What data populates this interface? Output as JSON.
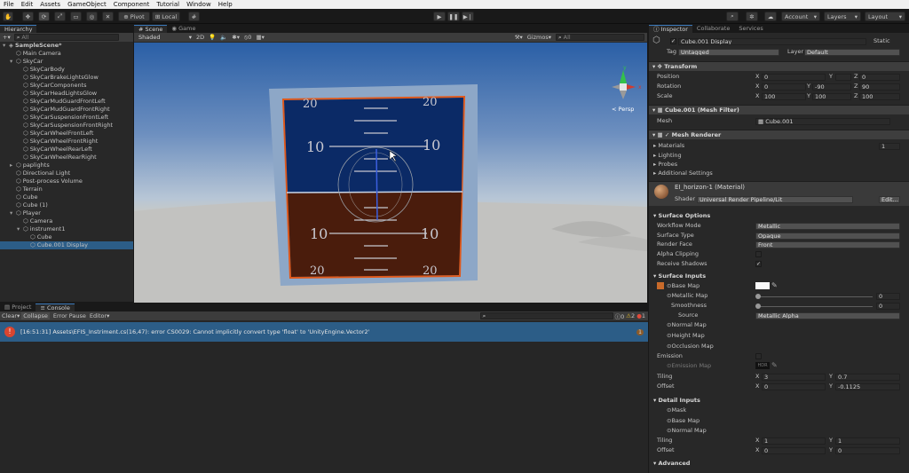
{
  "menubar": [
    "File",
    "Edit",
    "Assets",
    "GameObject",
    "Component",
    "Tutorial",
    "Window",
    "Help"
  ],
  "toolbar": {
    "pivot": "Pivot",
    "local": "Local",
    "account": "Account",
    "layers": "Layers",
    "layout": "Layout"
  },
  "hierarchy": {
    "tab": "Hierarchy",
    "search_placeholder": "All",
    "items": [
      {
        "label": "SampleScene*",
        "depth": 0
      },
      {
        "label": "Main Camera",
        "depth": 1
      },
      {
        "label": "SkyCar",
        "depth": 1
      },
      {
        "label": "SkyCarBody",
        "depth": 2
      },
      {
        "label": "SkyCarBrakeLightsGlow",
        "depth": 2
      },
      {
        "label": "SkyCarComponents",
        "depth": 2
      },
      {
        "label": "SkyCarHeadLightsGlow",
        "depth": 2
      },
      {
        "label": "SkyCarMudGuardFrontLeft",
        "depth": 2
      },
      {
        "label": "SkyCarMudGuardFrontRight",
        "depth": 2
      },
      {
        "label": "SkyCarSuspensionFrontLeft",
        "depth": 2
      },
      {
        "label": "SkyCarSuspensionFrontRight",
        "depth": 2
      },
      {
        "label": "SkyCarWheelFrontLeft",
        "depth": 2
      },
      {
        "label": "SkyCarWheelFrontRight",
        "depth": 2
      },
      {
        "label": "SkyCarWheelRearLeft",
        "depth": 2
      },
      {
        "label": "SkyCarWheelRearRight",
        "depth": 2
      },
      {
        "label": "paplights",
        "depth": 1
      },
      {
        "label": "Directional Light",
        "depth": 1
      },
      {
        "label": "Post-process Volume",
        "depth": 1
      },
      {
        "label": "Terrain",
        "depth": 1
      },
      {
        "label": "Cube",
        "depth": 1
      },
      {
        "label": "Cube (1)",
        "depth": 1
      },
      {
        "label": "Player",
        "depth": 1
      },
      {
        "label": "Camera",
        "depth": 2
      },
      {
        "label": "instrument1",
        "depth": 2
      },
      {
        "label": "Cube",
        "depth": 3
      },
      {
        "label": "Cube.001 Display",
        "depth": 3
      }
    ]
  },
  "scene": {
    "tabs": [
      "Scene",
      "Game"
    ],
    "shading": "Shaded",
    "mode_2d": "2D",
    "gizmos": "Gizmos",
    "search_placeholder": "All",
    "persp": "< Persp",
    "fx_count": "0",
    "horizon_marks_top": [
      "20",
      "10",
      "20",
      "10"
    ],
    "horizon_marks_bottom": [
      "10",
      "10",
      "20",
      "20"
    ],
    "gizmo_axes": {
      "x": "x",
      "y": "y",
      "z": "z"
    }
  },
  "console": {
    "tabs": [
      "Project",
      "Console"
    ],
    "buttons": {
      "clear": "Clear",
      "collapse": "Collapse",
      "error_pause": "Error Pause",
      "editor": "Editor"
    },
    "counts": {
      "info": "0",
      "warn": "2",
      "error": "1"
    },
    "error_text": "[16:51:31] Assets\\EFIS_Instriment.cs(16,47): error CS0029: Cannot implicitly convert type 'float' to 'UnityEngine.Vector2'",
    "error_count": "1"
  },
  "inspector": {
    "tabs": [
      "Inspector",
      "Collaborate",
      "Services"
    ],
    "object_name": "Cube.001 Display",
    "static": "Static",
    "tag_label": "Tag",
    "tag": "Untagged",
    "layer_label": "Layer",
    "layer": "Default",
    "transform": {
      "title": "Transform",
      "position": {
        "label": "Position",
        "x": "0",
        "y": "0",
        "z": "0"
      },
      "rotation": {
        "label": "Rotation",
        "x": "0",
        "y": "-90",
        "z": "90"
      },
      "scale": {
        "label": "Scale",
        "x": "100",
        "y": "100",
        "z": "100"
      }
    },
    "mesh_filter": {
      "title": "Cube.001 (Mesh Filter)",
      "mesh_label": "Mesh",
      "mesh": "Cube.001"
    },
    "mesh_renderer": {
      "title": "Mesh Renderer",
      "materials": "Materials",
      "materials_count": "1",
      "lighting": "Lighting",
      "probes": "Probes",
      "additional": "Additional Settings"
    },
    "material": {
      "name": "EI_horizon-1 (Material)",
      "shader_label": "Shader",
      "shader": "Universal Render Pipeline/Lit",
      "edit": "Edit..."
    },
    "surface_options": {
      "title": "Surface Options",
      "workflow": {
        "label": "Workflow Mode",
        "value": "Metallic"
      },
      "surface_type": {
        "label": "Surface Type",
        "value": "Opaque"
      },
      "render_face": {
        "label": "Render Face",
        "value": "Front"
      },
      "alpha_clipping": "Alpha Clipping",
      "receive_shadows": "Receive Shadows"
    },
    "surface_inputs": {
      "title": "Surface Inputs",
      "base_map": "Base Map",
      "metallic_map": "Metallic Map",
      "metallic_value": "0",
      "smoothness": "Smoothness",
      "smoothness_value": "0",
      "source": "Source",
      "source_value": "Metallic Alpha",
      "normal_map": "Normal Map",
      "height_map": "Height Map",
      "occlusion_map": "Occlusion Map",
      "emission": "Emission",
      "emission_map": "Emission Map",
      "hdr": "HDR",
      "tiling": {
        "label": "Tiling",
        "x": "3",
        "y": "0.7"
      },
      "offset": {
        "label": "Offset",
        "x": "0",
        "y": "-0.1125"
      }
    },
    "detail_inputs": {
      "title": "Detail Inputs",
      "mask": "Mask",
      "base_map": "Base Map",
      "normal_map": "Normal Map",
      "tiling": {
        "label": "Tiling",
        "x": "1",
        "y": "1"
      },
      "offset": {
        "label": "Offset",
        "x": "0",
        "y": "0"
      }
    },
    "advanced": "Advanced"
  },
  "colors": {
    "selection": "#2c5d87",
    "error_row": "#2c5d87",
    "instrument_sky": "#0b2a66",
    "instrument_ground": "#4a1c0c",
    "instrument_border": "#e0581a",
    "frame": "#8da7c7"
  }
}
